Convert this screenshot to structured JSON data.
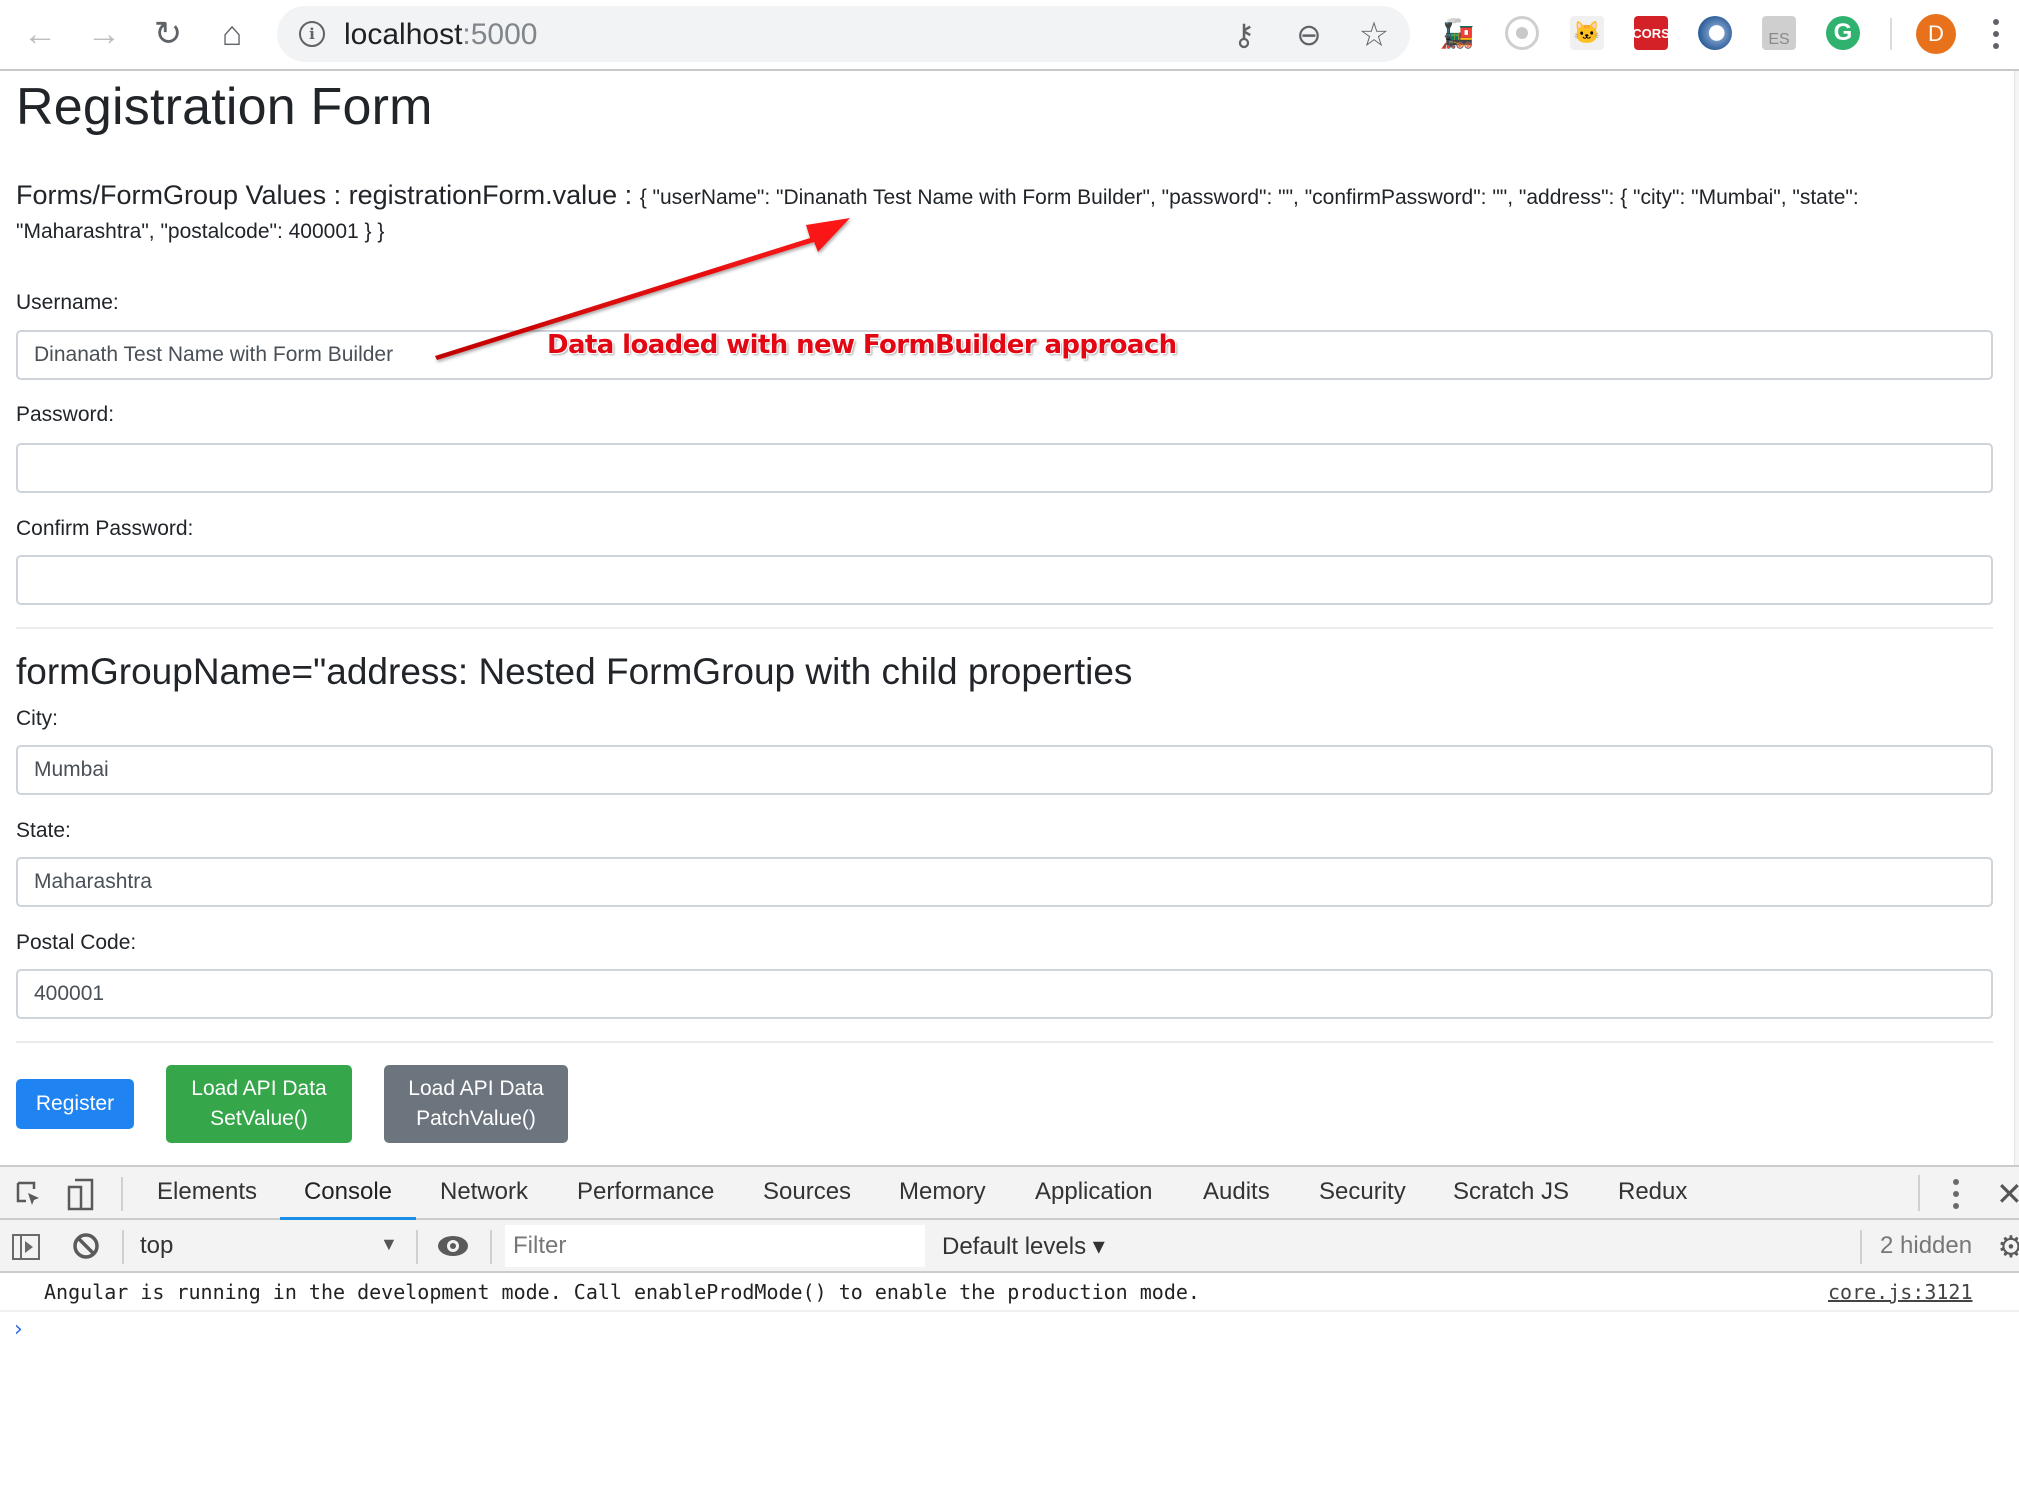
{
  "browser": {
    "url_host": "localhost",
    "url_port": ":5000",
    "nav": {
      "back_icon": "←",
      "forward_icon": "→",
      "reload_icon": "↻",
      "home_icon": "⌂"
    },
    "omnibox_icons": {
      "info": "i",
      "key": "⚷",
      "zoom": "⊖",
      "star": "☆"
    },
    "extensions": [
      {
        "name": "train-extension",
        "glyph": "🚂"
      },
      {
        "name": "target-extension",
        "glyph": ""
      },
      {
        "name": "octocat-extension",
        "glyph": "🐱"
      },
      {
        "name": "cors-extension",
        "glyph": "CORS"
      },
      {
        "name": "json-viewer-extension",
        "glyph": ""
      },
      {
        "name": "es-extension",
        "glyph": "ES"
      },
      {
        "name": "grammarly-extension",
        "glyph": "G"
      }
    ],
    "profile_initial": "D"
  },
  "page": {
    "title": "Registration Form",
    "values_label": "Forms/FormGroup Values : registrationForm.value : ",
    "values_json": "{ \"userName\": \"Dinanath Test Name with Form Builder\", \"password\": \"\", \"confirmPassword\": \"\", \"address\": { \"city\": \"Mumbai\", \"state\": \"Maharashtra\", \"postalcode\": 400001 } }",
    "fields": {
      "username": {
        "label": "Username:",
        "value": "Dinanath Test Name with Form Builder"
      },
      "password": {
        "label": "Password:",
        "value": ""
      },
      "confirm_password": {
        "label": "Confirm Password:",
        "value": ""
      }
    },
    "address_heading": "formGroupName=\"address: Nested FormGroup with child properties",
    "address_fields": {
      "city": {
        "label": "City:",
        "value": "Mumbai"
      },
      "state": {
        "label": "State:",
        "value": "Maharashtra"
      },
      "postal_code": {
        "label": "Postal Code:",
        "value": "400001"
      }
    },
    "buttons": {
      "register": "Register",
      "setvalue_line1": "Load API Data",
      "setvalue_line2": "SetValue()",
      "patchvalue_line1": "Load API Data",
      "patchvalue_line2": "PatchValue()"
    },
    "annotation": "Data loaded with new FormBuilder approach",
    "colors": {
      "register": "#1f84f2",
      "setvalue": "#35a64a",
      "patchvalue": "#6c757d",
      "annotation": "#e30613"
    }
  },
  "devtools": {
    "tabs": [
      "Elements",
      "Console",
      "Network",
      "Performance",
      "Sources",
      "Memory",
      "Application",
      "Audits",
      "Security",
      "Scratch JS",
      "Redux"
    ],
    "active_tab": "Console",
    "context": "top",
    "filter_placeholder": "Filter",
    "levels": "Default levels ▾",
    "hidden_count": "2 hidden",
    "messages": [
      {
        "text": "Angular is running in the development mode. Call enableProdMode() to enable the production mode.",
        "source": "core.js:3121"
      }
    ],
    "prompt": "›"
  }
}
